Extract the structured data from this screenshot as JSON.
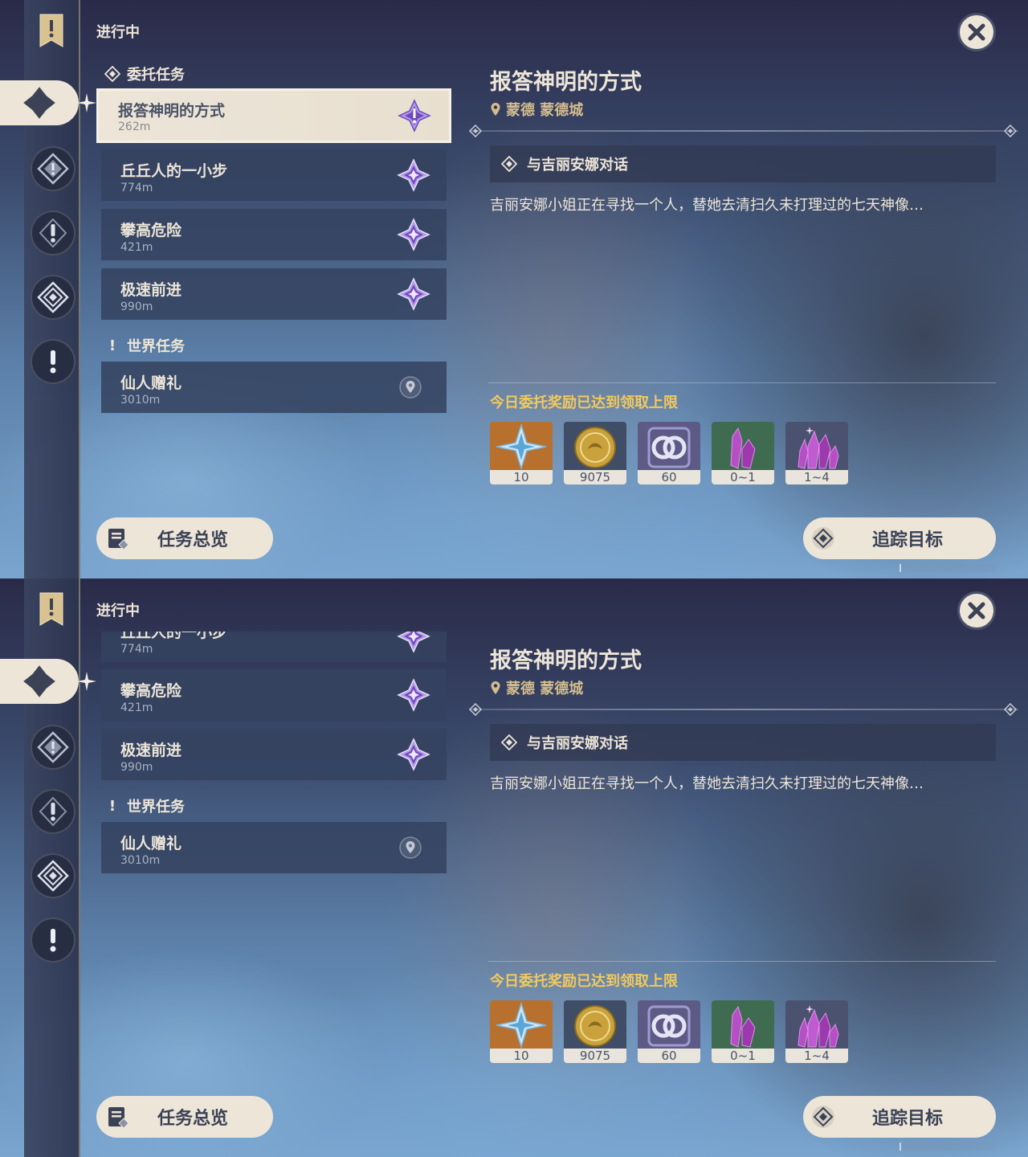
{
  "status_label": "进行中",
  "panels": [
    {
      "categories": {
        "commission": {
          "label": "委托任务"
        },
        "world": {
          "label": "世界任务"
        }
      },
      "quests": [
        {
          "title": "报答神明的方式",
          "distance": "262m",
          "active": true
        },
        {
          "title": "丘丘人的一小步",
          "distance": "774m"
        },
        {
          "title": "攀高危险",
          "distance": "421m"
        },
        {
          "title": "极速前进",
          "distance": "990m"
        },
        {
          "title": "仙人赠礼",
          "distance": "3010m"
        }
      ]
    },
    {
      "quests": [
        {
          "title": "丘丘人的一小步",
          "distance": "774m"
        },
        {
          "title": "攀高危险",
          "distance": "421m"
        },
        {
          "title": "极速前进",
          "distance": "990m"
        },
        {
          "title": "仙人赠礼",
          "distance": "3010m"
        }
      ],
      "categories": {
        "world": {
          "label": "世界任务"
        }
      }
    }
  ],
  "detail": {
    "title": "报答神明的方式",
    "location": "蒙德 蒙德城",
    "objective": "与吉丽安娜对话",
    "description": "吉丽安娜小姐正在寻找一个人，替她去清扫久未打理过的七天神像…",
    "reward_notice": "今日委托奖励已达到领取上限",
    "rewards": [
      {
        "icon": "primogem-icon",
        "count": "10",
        "bg": "#b8702e"
      },
      {
        "icon": "mora-icon",
        "count": "9075",
        "bg": "#3f4d66"
      },
      {
        "icon": "friendship-exp-icon",
        "count": "60",
        "bg": "#5d5a86"
      },
      {
        "icon": "crystal-icon",
        "count": "0~1",
        "bg": "#3f6b50"
      },
      {
        "icon": "crystal-cluster-icon",
        "count": "1~4",
        "bg": "#4a5270"
      }
    ]
  },
  "buttons": {
    "overview": "任务总览",
    "track": "追踪目标"
  },
  "colors": {
    "cream": "#ece5d8",
    "gold_text": "#d3bc8e",
    "notice_yellow": "#f2c95b",
    "quest_purple": "#8e67d6"
  }
}
